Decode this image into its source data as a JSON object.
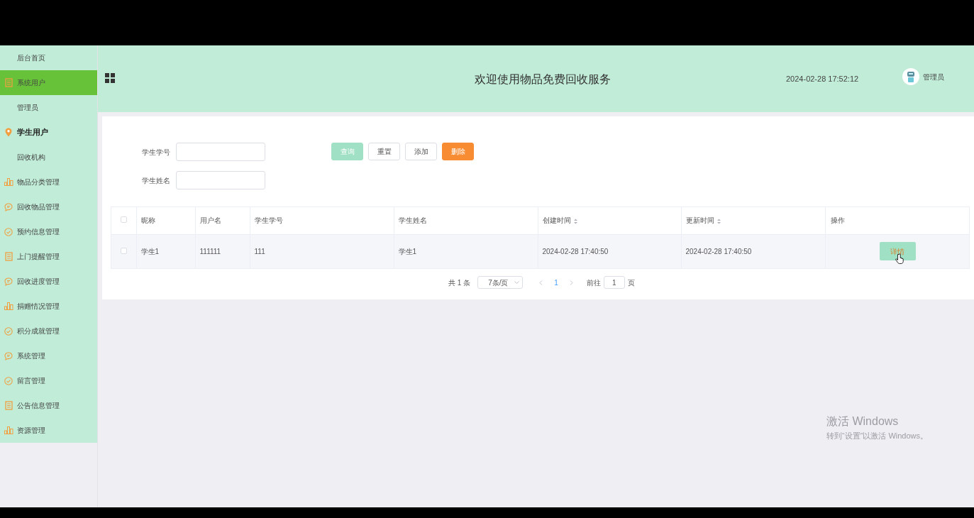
{
  "sidebar": {
    "items": [
      {
        "label": "后台首页",
        "kind": "plain",
        "selected": false,
        "emphasized": false
      },
      {
        "label": "系统用户",
        "kind": "document",
        "selected": true,
        "emphasized": false
      },
      {
        "label": "管理员",
        "kind": "plain",
        "selected": false,
        "emphasized": false
      },
      {
        "label": "学生用户",
        "kind": "location",
        "selected": false,
        "emphasized": true
      },
      {
        "label": "回收机构",
        "kind": "plain",
        "selected": false,
        "emphasized": false
      },
      {
        "label": "物品分类管理",
        "kind": "chart",
        "selected": false,
        "emphasized": false
      },
      {
        "label": "回收物品管理",
        "kind": "message",
        "selected": false,
        "emphasized": false
      },
      {
        "label": "预约信息管理",
        "kind": "task",
        "selected": false,
        "emphasized": false
      },
      {
        "label": "上门提醒管理",
        "kind": "document",
        "selected": false,
        "emphasized": false
      },
      {
        "label": "回收进度管理",
        "kind": "message",
        "selected": false,
        "emphasized": false
      },
      {
        "label": "捐赠情况管理",
        "kind": "chart",
        "selected": false,
        "emphasized": false
      },
      {
        "label": "积分成就管理",
        "kind": "task",
        "selected": false,
        "emphasized": false
      },
      {
        "label": "系统管理",
        "kind": "message",
        "selected": false,
        "emphasized": false
      },
      {
        "label": "留言管理",
        "kind": "task",
        "selected": false,
        "emphasized": false
      },
      {
        "label": "公告信息管理",
        "kind": "document",
        "selected": false,
        "emphasized": false
      },
      {
        "label": "资源管理",
        "kind": "chart",
        "selected": false,
        "emphasized": false
      }
    ]
  },
  "header": {
    "title": "欢迎使用物品免费回收服务",
    "datetime": "2024-02-28 17:52:12",
    "user": "管理员"
  },
  "search": {
    "fields": [
      {
        "label": "学生学号"
      },
      {
        "label": "学生姓名"
      }
    ],
    "buttons": [
      {
        "label": "查询",
        "kind": "primary"
      },
      {
        "label": "重置",
        "kind": "plain"
      },
      {
        "label": "添加",
        "kind": "plain"
      },
      {
        "label": "删除",
        "kind": "danger"
      }
    ]
  },
  "table": {
    "columns": [
      {
        "label": "昵称",
        "sortable": false
      },
      {
        "label": "用户名",
        "sortable": false
      },
      {
        "label": "学生学号",
        "sortable": false
      },
      {
        "label": "学生姓名",
        "sortable": false
      },
      {
        "label": "创建时间",
        "sortable": true
      },
      {
        "label": "更新时间",
        "sortable": true
      },
      {
        "label": "操作",
        "sortable": false
      }
    ],
    "all_checked": false,
    "rows": [
      {
        "checked": false,
        "cells": [
          "学生1",
          "111111",
          "111",
          "学生1",
          "2024-02-28 17:40:50",
          "2024-02-28 17:40:50"
        ],
        "action": "详情"
      }
    ]
  },
  "pagination": {
    "total": "共 1 条",
    "page_size": "7条/页",
    "pages": [
      {
        "label": "1",
        "selected": true
      }
    ],
    "goto_label": "前往",
    "goto_value": "1",
    "page_suffix": "页"
  },
  "os_notice": {
    "title": "激活 Windows",
    "text": "转到“设置”以激活 Windows。"
  }
}
